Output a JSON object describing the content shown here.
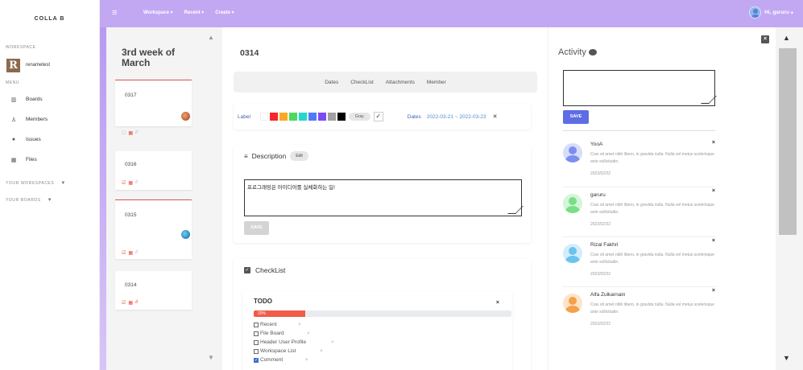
{
  "brand": "COLLA B",
  "sidebar": {
    "workspace_heading": "WORKSPACE",
    "workspace": {
      "initial": "R",
      "name": "renametest"
    },
    "menu_heading": "MENU",
    "menu": [
      {
        "label": "Boards",
        "icon": "board-icon"
      },
      {
        "label": "Members",
        "icon": "user-icon"
      },
      {
        "label": "Issues",
        "icon": "drop-icon"
      },
      {
        "label": "Files",
        "icon": "grid-icon"
      }
    ],
    "your_workspaces": "YOUR WORKSPACES",
    "your_boards": "YOUR BOARDS"
  },
  "topbar": {
    "nav": [
      "Workspace",
      "Recent",
      "Create"
    ],
    "greeting": "Hi, garuru"
  },
  "board": {
    "title": "3rd week of March",
    "cards": [
      "0317",
      "0316",
      "0315",
      "0314"
    ]
  },
  "detail": {
    "title": "0314",
    "tabs": [
      "Dates",
      "CheckList",
      "Attachments",
      "Member"
    ],
    "label_text": "Label",
    "colors": [
      "#ffffff",
      "#f5272c",
      "#f9a825",
      "#4cd95f",
      "#25d7c9",
      "#4f7cf6",
      "#7b4bf6",
      "#a0a0a0",
      "#000000"
    ],
    "gray_label": "Gray",
    "check_mark": "✓",
    "dates_label": "Dates",
    "dates_value": "2022-03-21 ~ 2022-03-23",
    "close": "✕",
    "description_label": "Description",
    "edit_label": "Edit",
    "description_text": "프로그래밍은 아이디어를 실체화하는 일!",
    "save_label": "SAVE",
    "checklist_label": "CheckList",
    "todo": {
      "title": "TODO",
      "close": "×",
      "progress_label": "20%",
      "progress": 0.2,
      "items": [
        {
          "label": "Recent",
          "checked": false
        },
        {
          "label": "File Board",
          "checked": false
        },
        {
          "label": "Header User Profile",
          "checked": false
        },
        {
          "label": "Workspace List",
          "checked": false
        },
        {
          "label": "Comment",
          "checked": true
        }
      ],
      "remove": "×"
    }
  },
  "activity": {
    "title": "Activity",
    "close": "×",
    "save_label": "SAVE",
    "items": [
      {
        "name": "YooA",
        "text": "Cras sit amet nibh libero, in gravida nulla. Nulla vel metus scelerisque ante sollicitudin.",
        "date": "2022/02/22",
        "color": "#7c8ff0",
        "bg": "#d8def9"
      },
      {
        "name": "garuru",
        "text": "Cras sit amet nibh libero, in gravida nulla. Nulla vel metus scelerisque ante sollicitudin.",
        "date": "2022/02/22",
        "color": "#79df86",
        "bg": "#d5f5d9"
      },
      {
        "name": "Rizal Fakhri",
        "text": "Cras sit amet nibh libero, in gravida nulla. Nulla vel metus scelerisque ante sollicitudin.",
        "date": "2022/02/22",
        "color": "#6bc3ee",
        "bg": "#d3edfa"
      },
      {
        "name": "Alfa Zulkarnain",
        "text": "Cras sit amet nibh libero, in gravida nulla. Nulla vel metus scelerisque ante sollicitudin.",
        "date": "2022/02/22",
        "color": "#f5a04a",
        "bg": "#fde4c8"
      }
    ],
    "remove": "×"
  }
}
